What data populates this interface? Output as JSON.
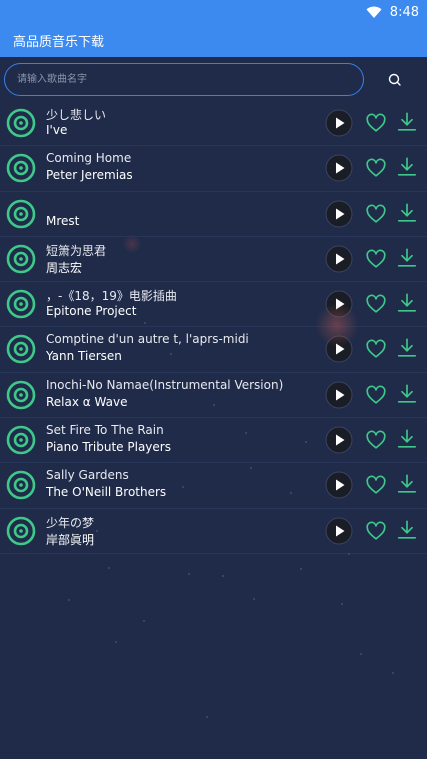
{
  "status_bar": {
    "time": "8:48"
  },
  "app_bar": {
    "title": "高品质音乐下载"
  },
  "search": {
    "placeholder": "请输入歌曲名字"
  },
  "songs": [
    {
      "title": "少し悲しい",
      "artist": "I've"
    },
    {
      "title": "Coming Home",
      "artist": "Peter Jeremias"
    },
    {
      "title": "",
      "artist": "Mrest"
    },
    {
      "title": "短箫为思君",
      "artist": "周志宏"
    },
    {
      "title": "，-《18，19》电影插曲",
      "artist": "Epitone Project"
    },
    {
      "title": "Comptine d'un autre t, l'aprs-midi",
      "artist": "Yann Tiersen"
    },
    {
      "title": "Inochi-No Namae(Instrumental Version)",
      "artist": "Relax α Wave"
    },
    {
      "title": "Set Fire To The Rain",
      "artist": "Piano Tribute Players"
    },
    {
      "title": "Sally Gardens",
      "artist": "The O'Neill Brothers"
    },
    {
      "title": "少年の梦",
      "artist": "岸部眞明"
    }
  ],
  "colors": {
    "accent": "#3c8af0",
    "green": "#3ec98a",
    "background": "#1f2b49"
  },
  "icons": {
    "disc": "disc-icon",
    "play": "play-icon",
    "favorite": "heart-icon",
    "download": "download-icon",
    "search": "search-icon",
    "wifi": "wifi-icon"
  }
}
